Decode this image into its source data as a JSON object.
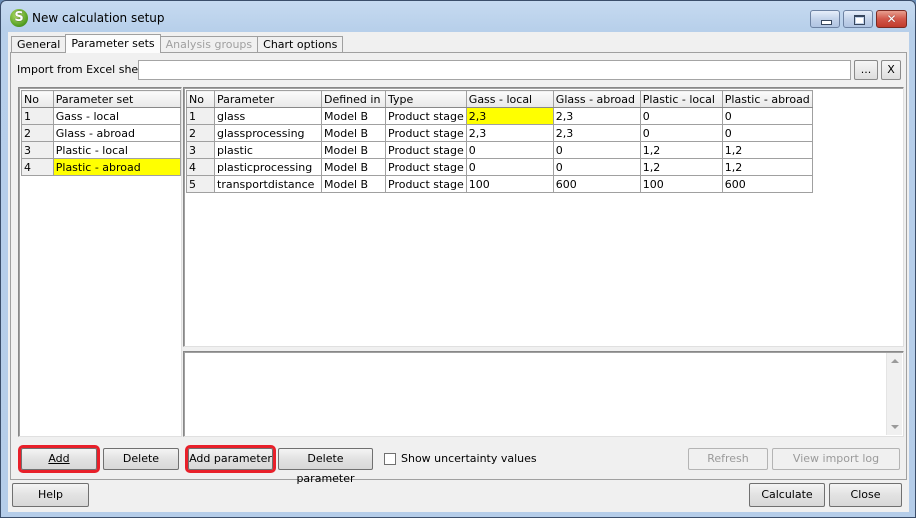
{
  "window": {
    "title": "New calculation setup",
    "app_icon_letter": "S",
    "controls": {
      "minimize": "minimize",
      "maximize": "maximize",
      "close_glyph": "✕"
    }
  },
  "tabs": [
    {
      "label": "General",
      "state": "normal"
    },
    {
      "label": "Parameter sets",
      "state": "active"
    },
    {
      "label": "Analysis groups",
      "state": "disabled"
    },
    {
      "label": "Chart options",
      "state": "normal"
    }
  ],
  "import": {
    "label": "Import from Excel sheet",
    "value": "",
    "browse_label": "...",
    "clear_label": "X"
  },
  "parameter_sets": {
    "headers": [
      "No",
      "Parameter set"
    ],
    "rows": [
      {
        "no": "1",
        "name": "Gass - local",
        "highlight": false
      },
      {
        "no": "2",
        "name": "Glass - abroad",
        "highlight": false
      },
      {
        "no": "3",
        "name": "Plastic - local",
        "highlight": false
      },
      {
        "no": "4",
        "name": "Plastic - abroad",
        "highlight": true
      }
    ]
  },
  "parameters": {
    "headers": [
      "No",
      "Parameter",
      "Defined in",
      "Type",
      "Gass - local",
      "Glass - abroad",
      "Plastic - local",
      "Plastic - abroad"
    ],
    "rows": [
      {
        "no": "1",
        "parameter": "glass",
        "defined_in": "Model B",
        "type": "Product stage",
        "values": [
          "2,3",
          "2,3",
          "0",
          "0"
        ]
      },
      {
        "no": "2",
        "parameter": "glassprocessing",
        "defined_in": "Model B",
        "type": "Product stage",
        "values": [
          "2,3",
          "2,3",
          "0",
          "0"
        ]
      },
      {
        "no": "3",
        "parameter": "plastic",
        "defined_in": "Model B",
        "type": "Product stage",
        "values": [
          "0",
          "0",
          "1,2",
          "1,2"
        ]
      },
      {
        "no": "4",
        "parameter": "plasticprocessing",
        "defined_in": "Model B",
        "type": "Product stage",
        "values": [
          "0",
          "0",
          "1,2",
          "1,2"
        ]
      },
      {
        "no": "5",
        "parameter": "transportdistance",
        "defined_in": "Model B",
        "type": "Product stage",
        "values": [
          "100",
          "600",
          "100",
          "600"
        ]
      }
    ],
    "highlight_color": "#ffff00"
  },
  "notes": {
    "value": ""
  },
  "buttons": {
    "add": "Add",
    "delete": "Delete",
    "add_parameter": "Add parameter",
    "delete_parameter": "Delete parameter",
    "show_uncertainty": "Show uncertainty values",
    "refresh": "Refresh",
    "view_import_log": "View import log",
    "help": "Help",
    "calculate": "Calculate",
    "close": "Close"
  },
  "show_uncertainty_checked": false,
  "annotation_color": "#e8202a"
}
